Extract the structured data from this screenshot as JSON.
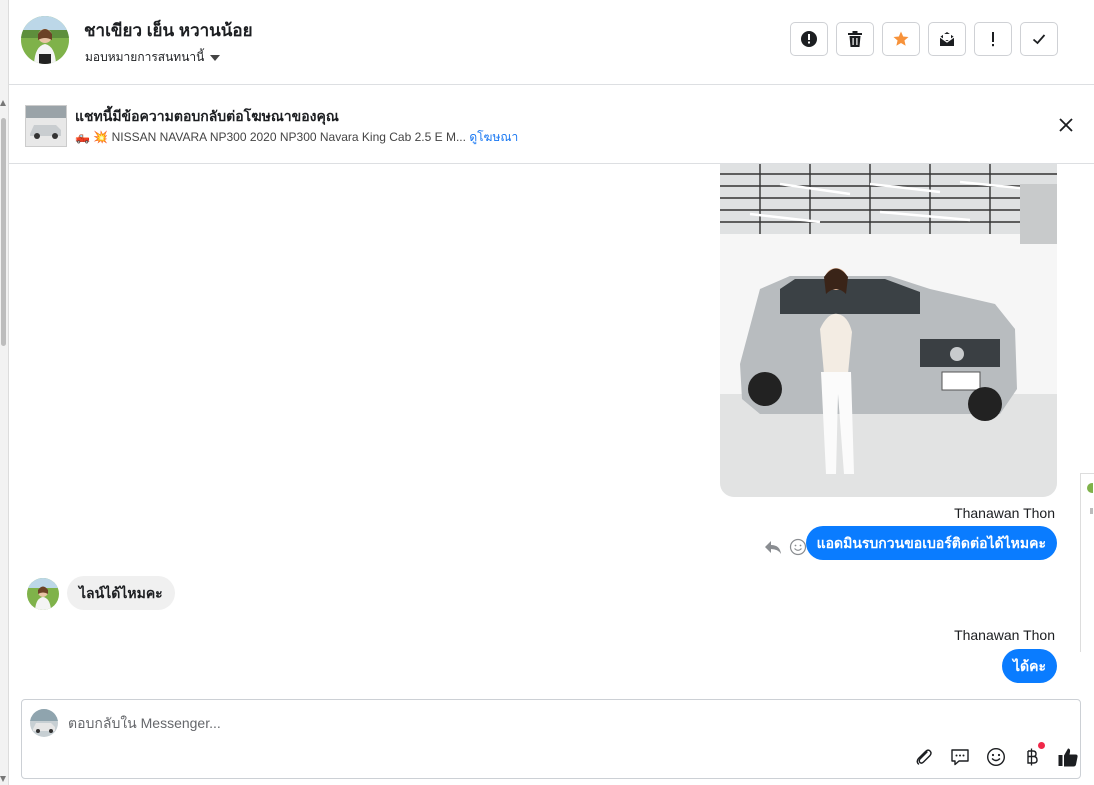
{
  "header": {
    "contact_name": "ชาเขียว เย็น หวานน้อย",
    "assign_label": "มอบหมายการสนทนานี้",
    "tools": [
      {
        "name": "report-spam",
        "icon": "exclamation-circle-icon"
      },
      {
        "name": "delete",
        "icon": "trash-icon"
      },
      {
        "name": "star",
        "icon": "star-icon",
        "color": "#f7923a"
      },
      {
        "name": "mark-unread",
        "icon": "envelope-icon"
      },
      {
        "name": "flag",
        "icon": "exclamation-icon"
      },
      {
        "name": "mark-done",
        "icon": "checkmark-icon"
      }
    ]
  },
  "ad_banner": {
    "title": "แชทนี้มีข้อความตอบกลับต่อโฆษณาของคุณ",
    "subtitle_emoji": "🛻 💥",
    "subtitle": "NISSAN NAVARA NP300 2020 NP300 Navara King Cab 2.5 E M...",
    "link_label": "ดูโฆษณา"
  },
  "messages": [
    {
      "direction": "out",
      "type": "image",
      "image_desc": "car-photo"
    },
    {
      "direction": "out",
      "sender": "Thanawan Thon",
      "text": "แอดมินรบกวนขอเบอร์ติดต่อได้ไหมคะ"
    },
    {
      "direction": "in",
      "text": "ไลน์ได้ไหมคะ"
    },
    {
      "direction": "out",
      "sender": "Thanawan Thon",
      "text": "ได้คะ"
    }
  ],
  "composer": {
    "placeholder": "ตอบกลับใน Messenger...",
    "value": "",
    "tools": [
      "paperclip-icon",
      "chat-bubble-icon",
      "emoji-icon",
      "baht-icon",
      "thumbs-up-icon"
    ]
  },
  "colors": {
    "accent": "#0a7cff",
    "star": "#f7923a",
    "notification_dot": "#f02849"
  }
}
